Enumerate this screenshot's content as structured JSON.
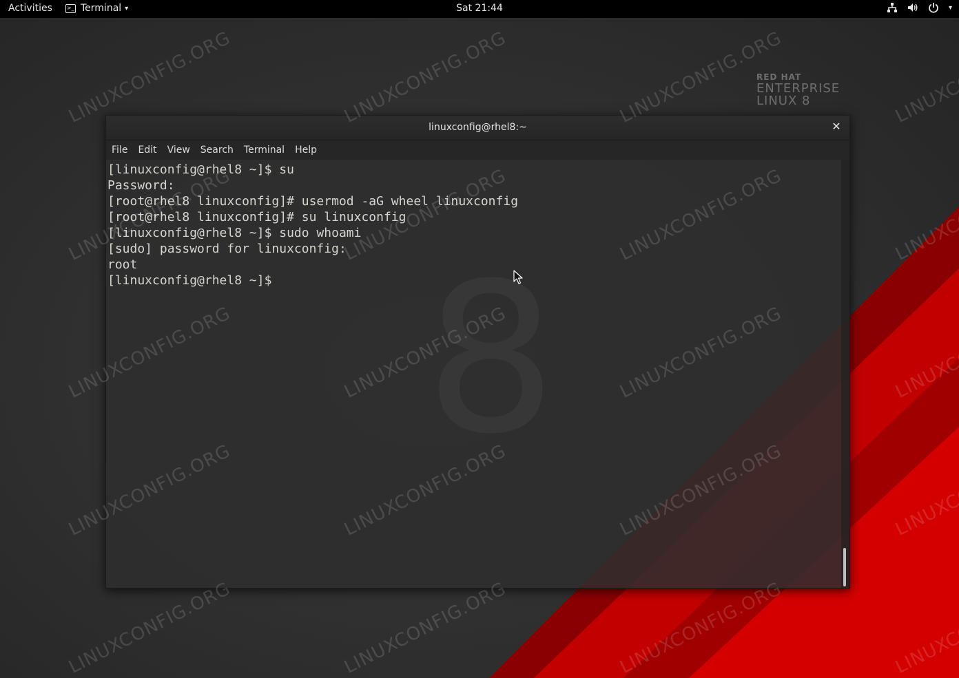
{
  "topbar": {
    "activities": "Activities",
    "app_name": "Terminal",
    "clock": "Sat 21:44",
    "icons": [
      "network-icon",
      "volume-icon",
      "power-icon",
      "caret-down-icon"
    ]
  },
  "wallpaper": {
    "watermark": "LINUXCONFIG.ORG",
    "brand": {
      "line1": "RED HAT",
      "line2": "ENTERPRISE",
      "line3": "LINUX 8"
    },
    "big_number": "8",
    "colors": {
      "background": "#2e2e2e",
      "stripe": "#cc0000"
    }
  },
  "window": {
    "title": "linuxconfig@rhel8:~",
    "close_label": "✕",
    "menu": [
      "File",
      "Edit",
      "View",
      "Search",
      "Terminal",
      "Help"
    ]
  },
  "terminal": {
    "lines": [
      "[linuxconfig@rhel8 ~]$ su",
      "Password:",
      "[root@rhel8 linuxconfig]# usermod -aG wheel linuxconfig",
      "[root@rhel8 linuxconfig]# su linuxconfig",
      "[linuxconfig@rhel8 ~]$ sudo whoami",
      "[sudo] password for linuxconfig:",
      "root",
      "[linuxconfig@rhel8 ~]$ "
    ],
    "foreground": "#d3d7cf",
    "background": "#2d2d2d"
  }
}
